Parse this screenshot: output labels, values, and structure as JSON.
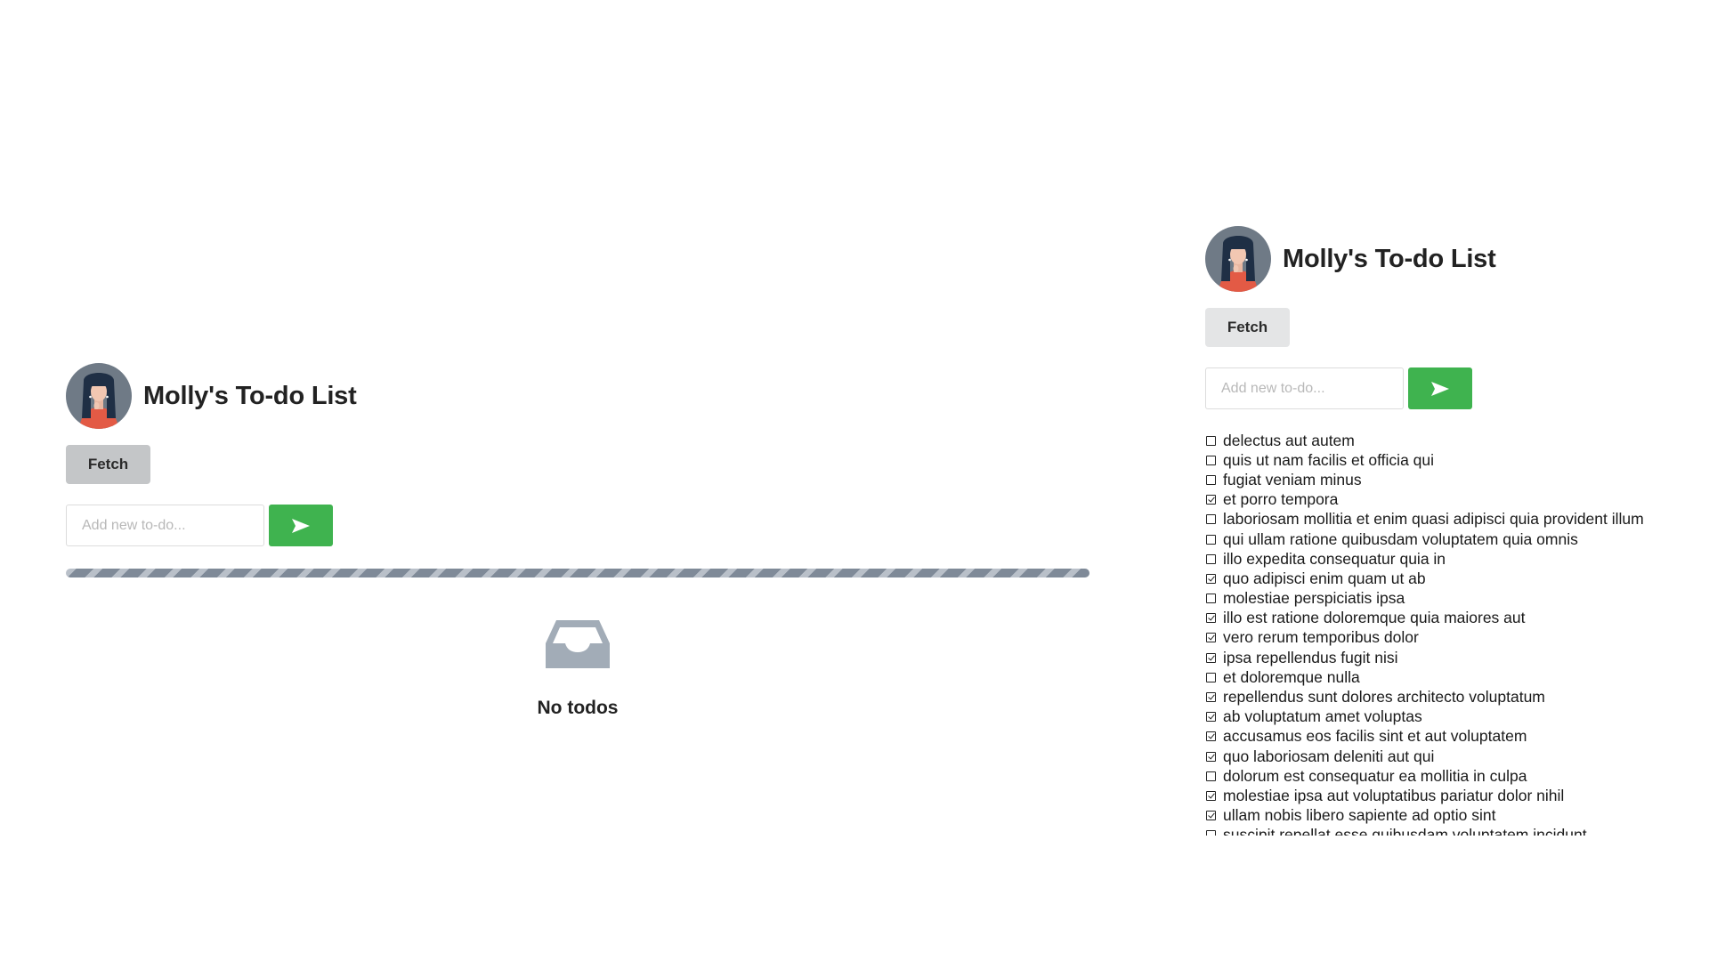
{
  "left_panel": {
    "title": "Molly's To-do List",
    "fetch_label": "Fetch",
    "input": {
      "placeholder": "Add new to-do...",
      "value": ""
    },
    "empty_text": "No todos"
  },
  "right_panel": {
    "title": "Molly's To-do List",
    "fetch_label": "Fetch",
    "input": {
      "placeholder": "Add new to-do...",
      "value": ""
    },
    "todos": [
      {
        "text": "delectus aut autem",
        "completed": false
      },
      {
        "text": "quis ut nam facilis et officia qui",
        "completed": false
      },
      {
        "text": "fugiat veniam minus",
        "completed": false
      },
      {
        "text": "et porro tempora",
        "completed": true
      },
      {
        "text": "laboriosam mollitia et enim quasi adipisci quia provident illum",
        "completed": false
      },
      {
        "text": "qui ullam ratione quibusdam voluptatem quia omnis",
        "completed": false
      },
      {
        "text": "illo expedita consequatur quia in",
        "completed": false
      },
      {
        "text": "quo adipisci enim quam ut ab",
        "completed": true
      },
      {
        "text": "molestiae perspiciatis ipsa",
        "completed": false
      },
      {
        "text": "illo est ratione doloremque quia maiores aut",
        "completed": true
      },
      {
        "text": "vero rerum temporibus dolor",
        "completed": true
      },
      {
        "text": "ipsa repellendus fugit nisi",
        "completed": true
      },
      {
        "text": "et doloremque nulla",
        "completed": false
      },
      {
        "text": "repellendus sunt dolores architecto voluptatum",
        "completed": true
      },
      {
        "text": "ab voluptatum amet voluptas",
        "completed": true
      },
      {
        "text": "accusamus eos facilis sint et aut voluptatem",
        "completed": true
      },
      {
        "text": "quo laboriosam deleniti aut qui",
        "completed": true
      },
      {
        "text": "dolorum est consequatur ea mollitia in culpa",
        "completed": false
      },
      {
        "text": "molestiae ipsa aut voluptatibus pariatur dolor nihil",
        "completed": true
      },
      {
        "text": "ullam nobis libero sapiente ad optio sint",
        "completed": true
      },
      {
        "text": "suscipit repellat esse quibusdam voluptatem incidunt",
        "completed": false
      }
    ]
  },
  "colors": {
    "accent_green": "#3fb34f",
    "fetch_loading_bg": "#c4c6c8",
    "fetch_idle_bg": "#e4e5e6",
    "progress_stripe": "#7f8a98",
    "empty_icon": "#a2acb7"
  },
  "icons": {
    "avatar": "avatar-woman-icon",
    "send": "send-arrow-icon",
    "empty": "inbox-tray-icon",
    "checkbox_checked": "checkbox-checked-icon",
    "checkbox_unchecked": "checkbox-unchecked-icon"
  }
}
